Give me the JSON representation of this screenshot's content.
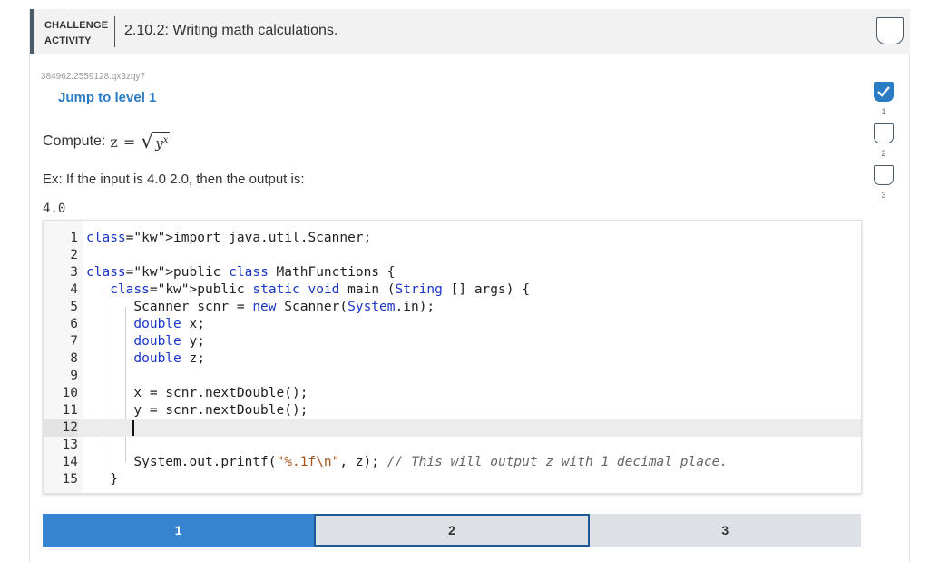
{
  "header": {
    "badge_line1": "CHALLENGE",
    "badge_line2": "ACTIVITY",
    "title": "2.10.2: Writing math calculations."
  },
  "activity": {
    "code_id": "384962.2559128.qx3zqy7",
    "jump_label": "Jump to level 1",
    "prompt_text": "Compute:",
    "formula": {
      "lhs": "z",
      "eq": "=",
      "radicand": "y",
      "exponent": "x"
    },
    "example_text": "Ex: If the input is 4.0 2.0, then the output is:",
    "example_output": "4.0"
  },
  "code": {
    "lines": [
      {
        "n": "1",
        "text": "import java.util.Scanner;"
      },
      {
        "n": "2",
        "text": ""
      },
      {
        "n": "3",
        "text": "public class MathFunctions {"
      },
      {
        "n": "4",
        "text": "   public static void main (String [] args) {"
      },
      {
        "n": "5",
        "text": "      Scanner scnr = new Scanner(System.in);"
      },
      {
        "n": "6",
        "text": "      double x;"
      },
      {
        "n": "7",
        "text": "      double y;"
      },
      {
        "n": "8",
        "text": "      double z;"
      },
      {
        "n": "9",
        "text": ""
      },
      {
        "n": "10",
        "text": "      x = scnr.nextDouble();"
      },
      {
        "n": "11",
        "text": "      y = scnr.nextDouble();"
      },
      {
        "n": "12",
        "text": ""
      },
      {
        "n": "13",
        "text": ""
      },
      {
        "n": "14",
        "text": "      System.out.printf(\"%.1f\\n\", z); // This will output z with 1 decimal place."
      },
      {
        "n": "15",
        "text": "   }"
      }
    ],
    "active_line": "12"
  },
  "level_tabs": [
    {
      "label": "1",
      "state": "completed"
    },
    {
      "label": "2",
      "state": "selected"
    },
    {
      "label": "3",
      "state": "locked"
    }
  ],
  "level_indicators": [
    {
      "num": "1",
      "done": true
    },
    {
      "num": "2",
      "done": false
    },
    {
      "num": "3",
      "done": false
    }
  ],
  "colors": {
    "accent": "#2a7bc4",
    "tab_active": "#3683d0",
    "tab_inactive": "#dde1e5",
    "keyword": "#1a36c7",
    "string": "#a3531c"
  }
}
